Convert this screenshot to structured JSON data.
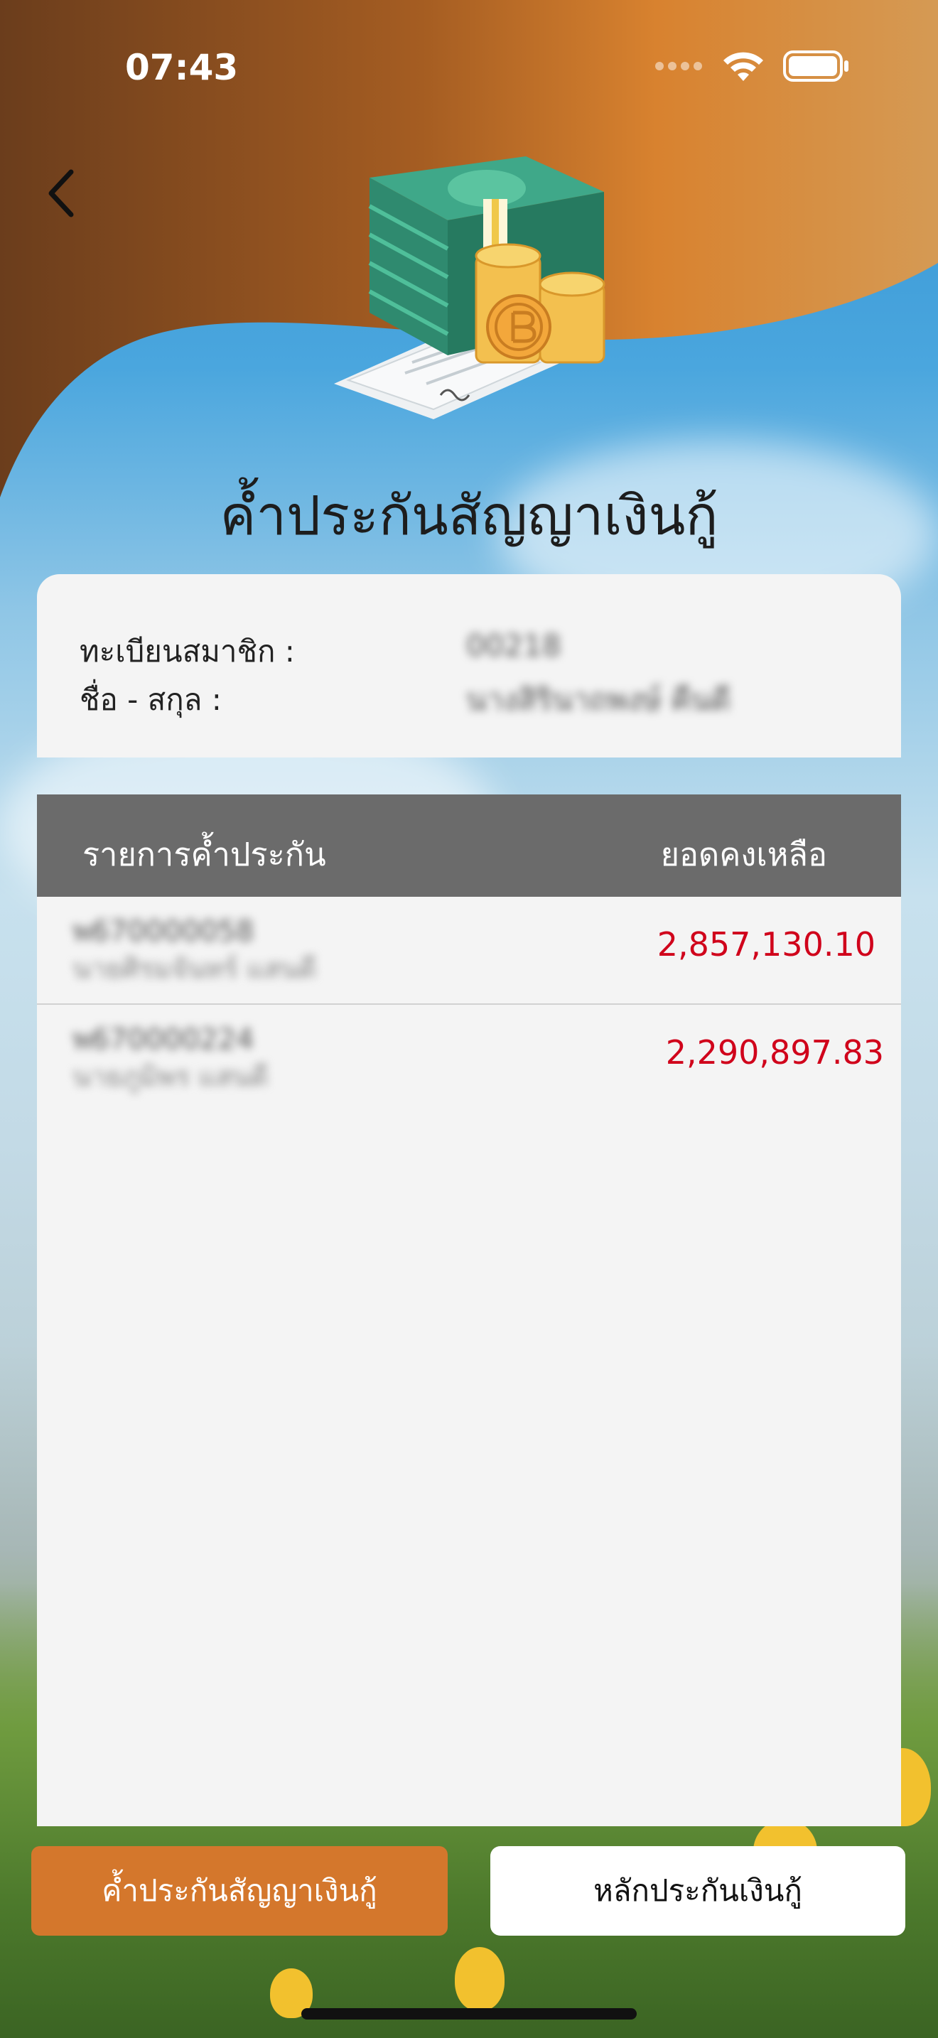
{
  "status_bar": {
    "time": "07:43"
  },
  "page": {
    "title": "ค้ำประกันสัญญาเงินกู้"
  },
  "member": {
    "id_label": "ทะเบียนสมาชิก :",
    "id_value": "00218",
    "name_label": "ชื่อ - สกุล :",
    "name_value": "นางสิรินาถพงษ์ คืนดี"
  },
  "table": {
    "col_left": "รายการค้ำประกัน",
    "col_right": "ยอดคงเหลือ",
    "rows": [
      {
        "contract": "พ670000058",
        "borrower": "นายศิรมจันทร์ แสนดี",
        "balance": "2,857,130.10"
      },
      {
        "contract": "พ670000224",
        "borrower": "นายภูมิพร แสนดี",
        "balance": "2,290,897.83"
      }
    ]
  },
  "buttons": {
    "guarantee": "ค้ำประกันสัญญาเงินกู้",
    "collateral": "หลักประกันเงินกู้"
  },
  "colors": {
    "accent": "#d4772c",
    "amount": "#d0021b",
    "header": "#6b6b6b"
  }
}
